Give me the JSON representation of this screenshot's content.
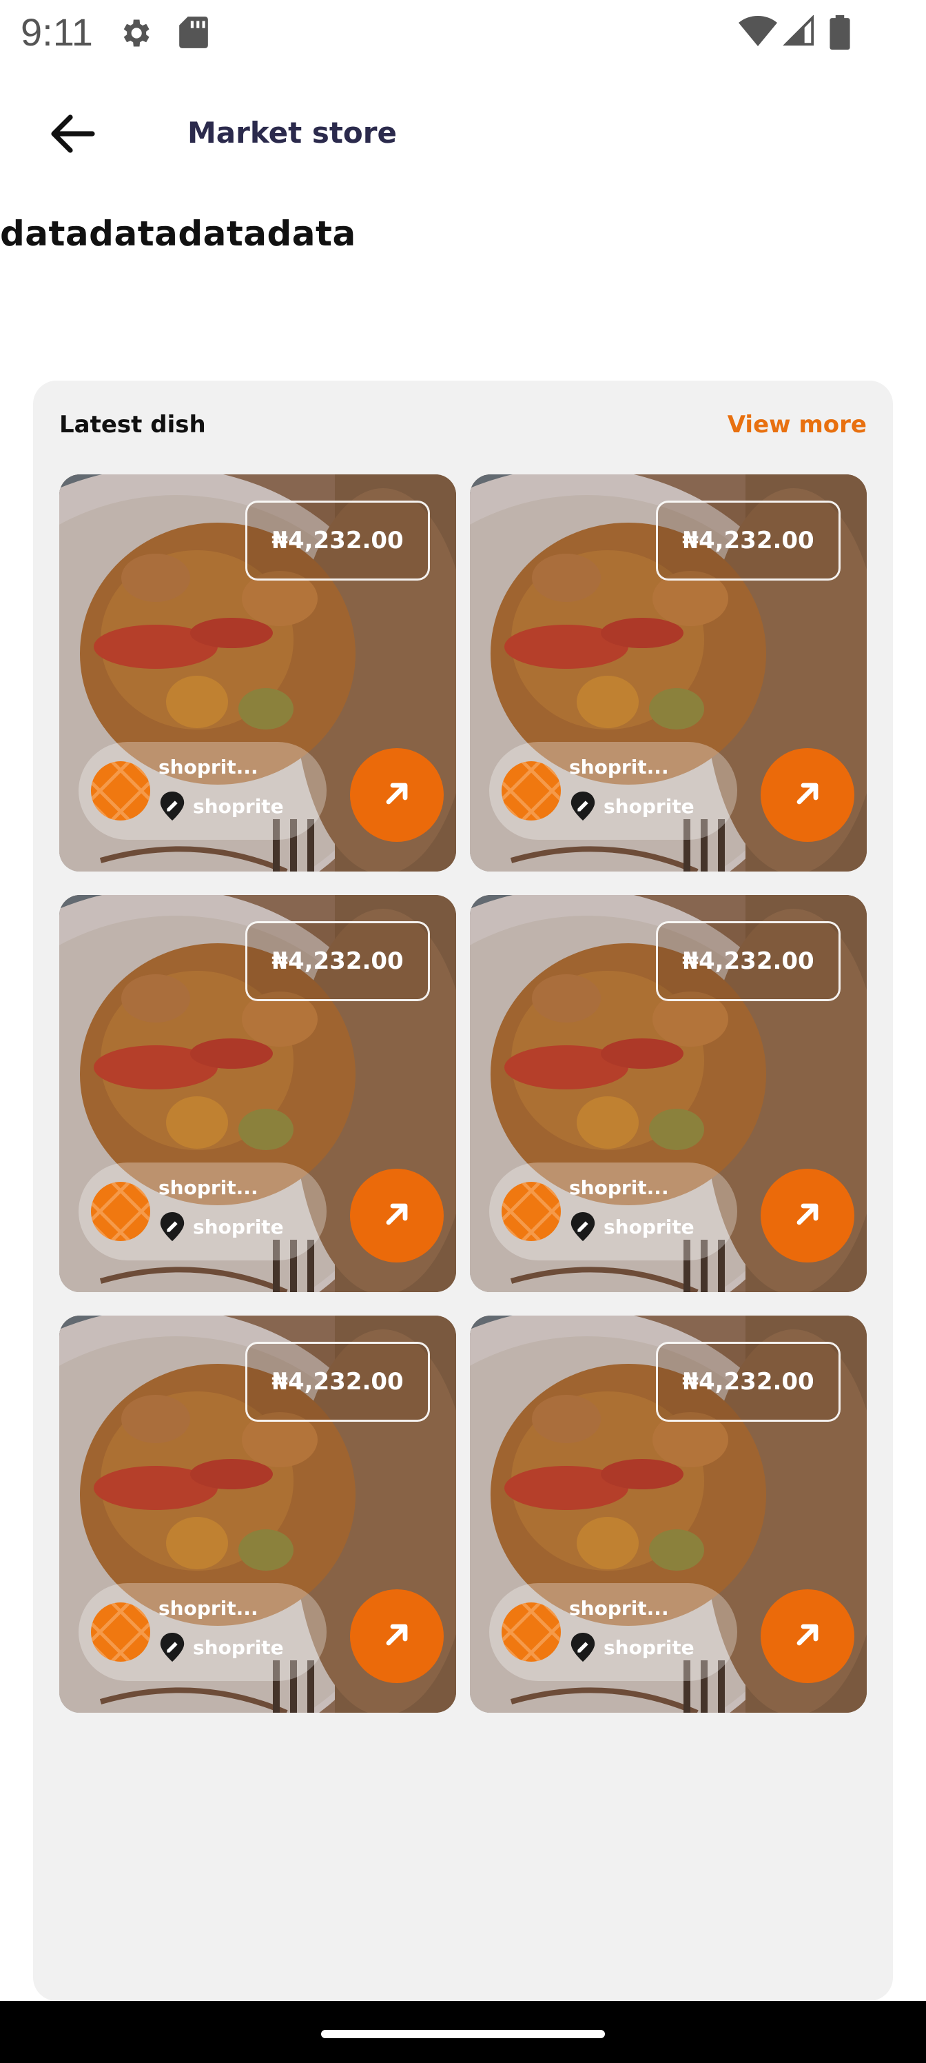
{
  "status_bar": {
    "time": "9:11",
    "icons": [
      "gear-icon",
      "sdcard-icon",
      "wifi-icon",
      "signal-icon",
      "battery-icon"
    ]
  },
  "app_bar": {
    "back_icon": "arrow-left-icon",
    "title": "Market store"
  },
  "headline": "datadatadatadata",
  "section": {
    "title": "Latest dish",
    "view_more": "View more"
  },
  "cards": [
    {
      "price": "₦4,232.00",
      "store_name": "shoprit...",
      "location": "shoprite"
    },
    {
      "price": "₦4,232.00",
      "store_name": "shoprit...",
      "location": "shoprite"
    },
    {
      "price": "₦4,232.00",
      "store_name": "shoprit...",
      "location": "shoprite"
    },
    {
      "price": "₦4,232.00",
      "store_name": "shoprit...",
      "location": "shoprite"
    },
    {
      "price": "₦4,232.00",
      "store_name": "shoprit...",
      "location": "shoprite"
    },
    {
      "price": "₦4,232.00",
      "store_name": "shoprit...",
      "location": "shoprite"
    }
  ],
  "colors": {
    "accent": "#eb6a0a",
    "title": "#2b2a4c",
    "panel": "#f1f1f1"
  }
}
